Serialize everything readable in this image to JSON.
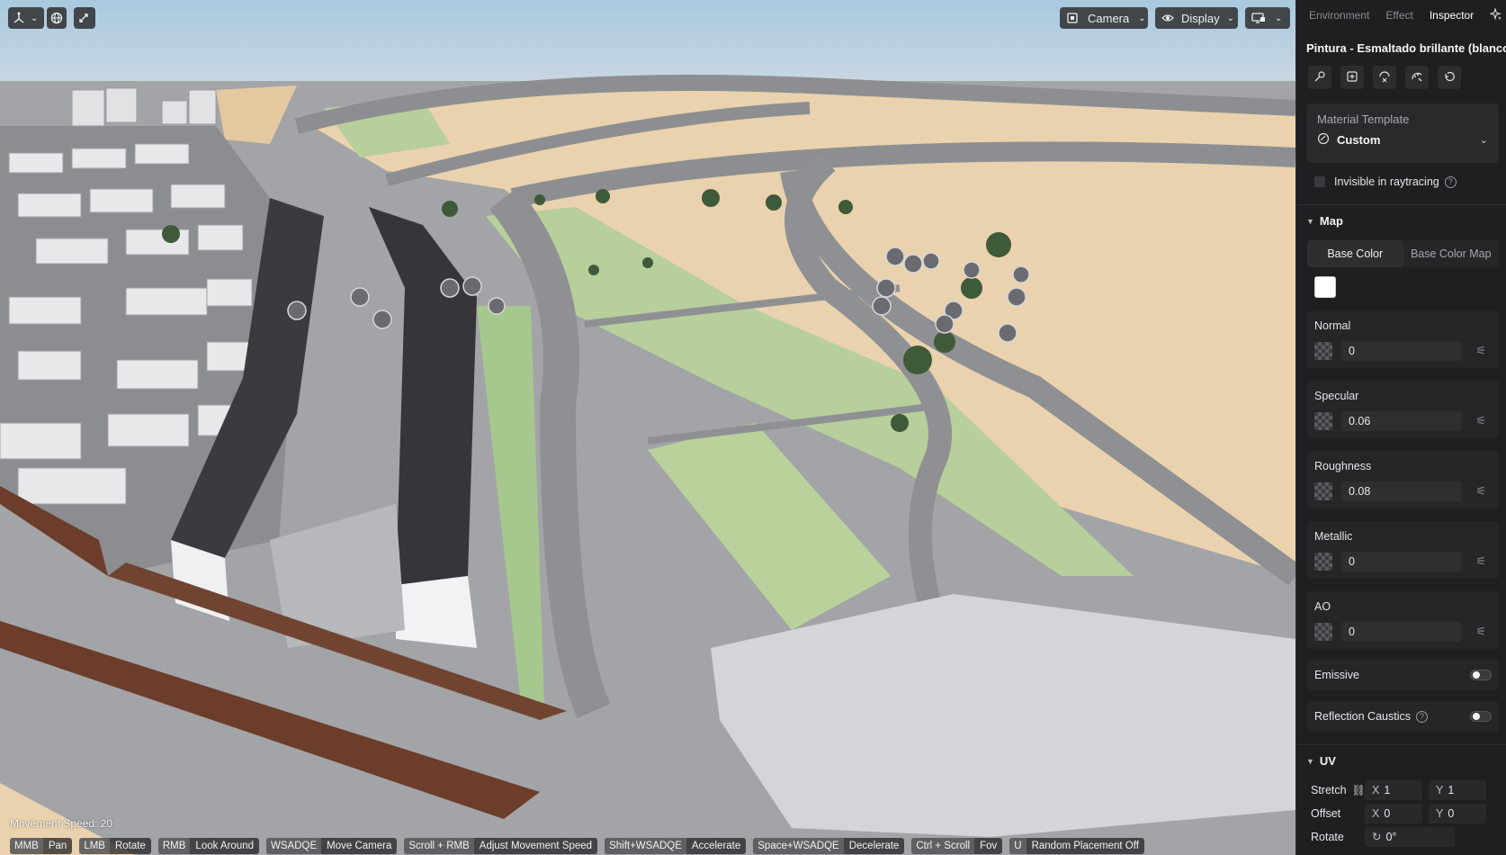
{
  "viewport": {
    "toolbar": {
      "camera_label": "Camera",
      "display_label": "Display"
    },
    "movement_speed": "Movement Speed: 20",
    "shortcuts": [
      {
        "key": "MMB",
        "action": "Pan"
      },
      {
        "key": "LMB",
        "action": "Rotate"
      },
      {
        "key": "RMB",
        "action": "Look Around"
      },
      {
        "key": "WSADQE",
        "action": "Move Camera"
      },
      {
        "key": "Scroll + RMB",
        "action": "Adjust Movement Speed"
      },
      {
        "key": "Shift+WSADQE",
        "action": "Accelerate"
      },
      {
        "key": "Space+WSADQE",
        "action": "Decelerate"
      },
      {
        "key": "Ctrl + Scroll",
        "action": "Fov"
      },
      {
        "key": "U",
        "action": "Random Placement Off"
      }
    ]
  },
  "panel": {
    "tabs": [
      "Environment",
      "Effect",
      "Inspector"
    ],
    "active_tab": "Inspector",
    "material_title": "Pintura - Esmaltado brillante (blanco)",
    "template": {
      "label": "Material Template",
      "value": "Custom"
    },
    "invisible_in_raytracing": "Invisible in raytracing",
    "map": {
      "header": "Map",
      "tabs": [
        "Base Color",
        "Base Color Map"
      ],
      "base_color": "#ffffff",
      "props": [
        {
          "label": "Normal",
          "value": "0"
        },
        {
          "label": "Specular",
          "value": "0.06"
        },
        {
          "label": "Roughness",
          "value": "0.08"
        },
        {
          "label": "Metallic",
          "value": "0"
        },
        {
          "label": "AO",
          "value": "0"
        }
      ],
      "emissive": "Emissive",
      "reflection_caustics": "Reflection Caustics"
    },
    "uv": {
      "header": "UV",
      "stretch": {
        "label": "Stretch",
        "x": "1",
        "y": "1"
      },
      "offset": {
        "label": "Offset",
        "x": "0",
        "y": "0"
      },
      "rotate": {
        "label": "Rotate",
        "value": "0°"
      }
    }
  }
}
